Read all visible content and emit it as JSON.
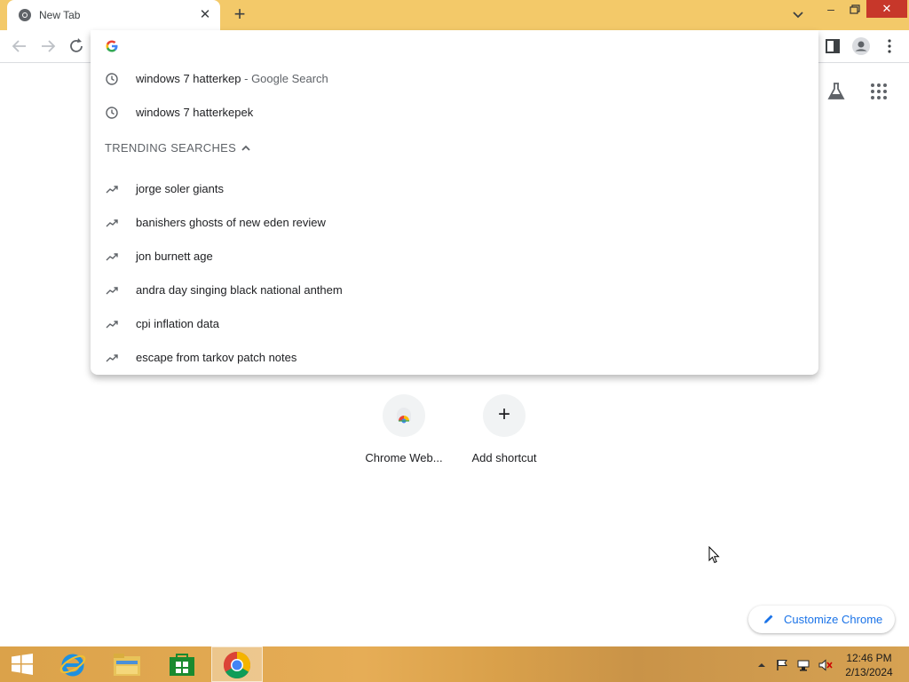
{
  "browser": {
    "tab": {
      "title": "New Tab"
    },
    "window_controls": {
      "minimize": "–",
      "close": "✕"
    },
    "newtab_label": "+"
  },
  "omnibox": {
    "input_value": "",
    "history": [
      {
        "text": "windows 7 hatterkep",
        "suffix": " - Google Search",
        "icon": "clock-icon"
      },
      {
        "text": "windows 7 hatterkepek",
        "suffix": "",
        "icon": "clock-icon"
      }
    ],
    "trending_header": "TRENDING SEARCHES",
    "trending": [
      "jorge soler giants",
      "banishers ghosts of new eden review",
      "jon burnett age",
      "andra day singing black national anthem",
      "cpi inflation data",
      "escape from tarkov patch notes"
    ]
  },
  "ntp": {
    "shortcuts": [
      {
        "label": "Chrome Web..."
      },
      {
        "label": "Add shortcut",
        "glyph": "+"
      }
    ],
    "customize_label": "Customize Chrome"
  },
  "taskbar": {
    "time": "12:46 PM",
    "date": "2/13/2024"
  },
  "colors": {
    "tabstrip": "#f3c969",
    "accent": "#1a73e8",
    "close_red": "#c7372a"
  }
}
